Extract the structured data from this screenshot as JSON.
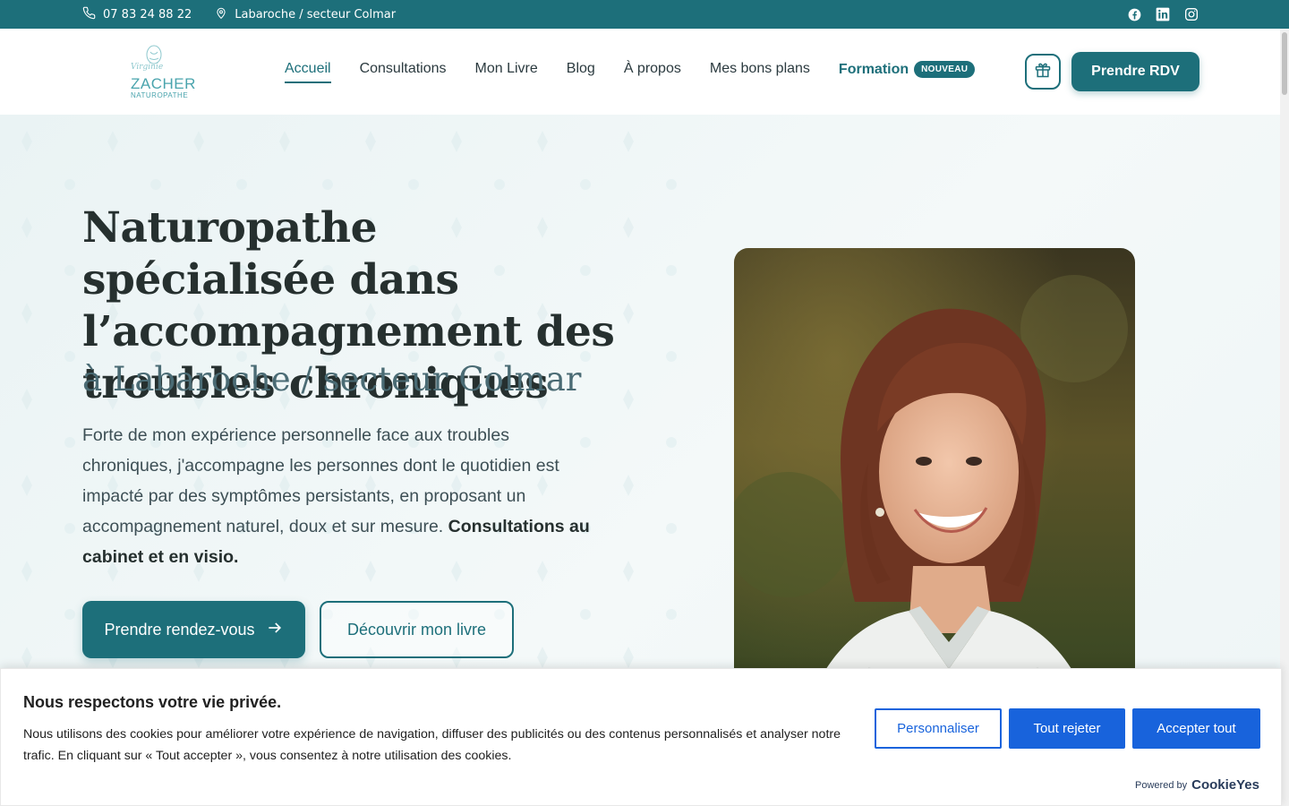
{
  "topbar": {
    "phone": "07 83 24 88 22",
    "location": "Labaroche / secteur Colmar",
    "social": [
      "facebook-icon",
      "linkedin-icon",
      "instagram-icon"
    ]
  },
  "header": {
    "logo": {
      "script": "Virginie",
      "name": "ZACHER",
      "sub": "NATUROPATHE"
    },
    "nav": [
      {
        "label": "Accueil"
      },
      {
        "label": "Consultations"
      },
      {
        "label": "Mon Livre"
      },
      {
        "label": "Blog"
      },
      {
        "label": "À propos"
      },
      {
        "label": "Mes bons plans"
      },
      {
        "label": "Formation"
      }
    ],
    "formation_badge": "NOUVEAU",
    "rdv_label": "Prendre RDV"
  },
  "hero": {
    "title": "Naturopathe spécialisée dans l’accompagnement des troubles chroniques",
    "subtitle": "à Labaroche / secteur Colmar",
    "intro": "Forte de mon expérience personnelle face aux troubles chroniques, j'accompagne les personnes dont le quotidien est impacté par des symptômes persistants, en proposant un accompagnement naturel, doux et sur mesure.",
    "intro_bold": "Consultations au cabinet et en visio.",
    "primary_button": "Prendre rendez-vous",
    "secondary_button": "Découvrir mon livre"
  },
  "cookie": {
    "title": "Nous respectons votre vie privée.",
    "text": "Nous utilisons des cookies pour améliorer votre expérience de navigation, diffuser des publicités ou des contenus personnalisés et analyser notre trafic. En cliquant sur « Tout accepter », vous consentez à notre utilisation des cookies.",
    "customize": "Personnaliser",
    "reject": "Tout rejeter",
    "accept": "Accepter tout",
    "powered_by": "Powered by",
    "brand": "CookieYes"
  },
  "colors": {
    "primary": "#1d6f7a",
    "cookie_blue": "#1863dc",
    "hero_bg": "#eef5f6"
  }
}
